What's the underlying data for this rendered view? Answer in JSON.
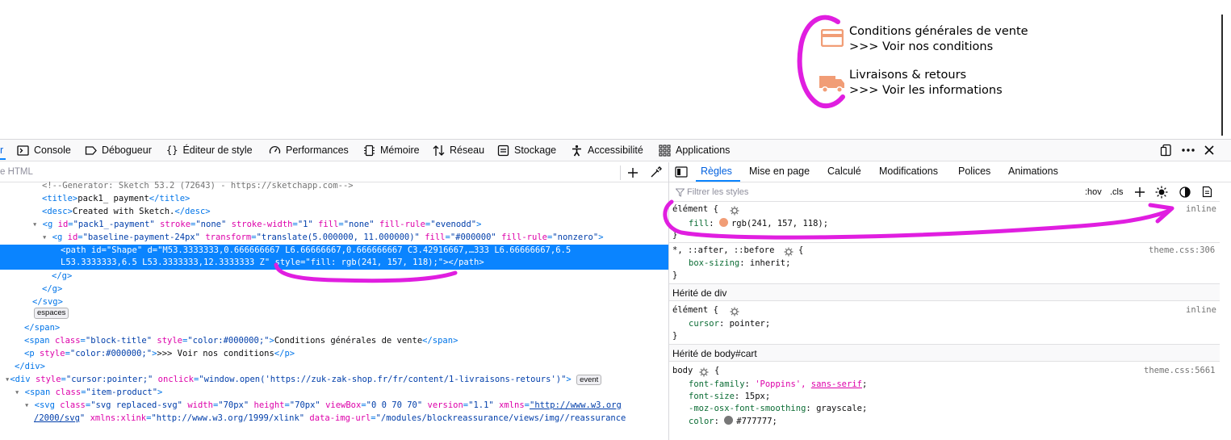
{
  "site": {
    "item1_title": "Conditions générales de vente",
    "item1_link": ">>> Voir nos conditions",
    "item2_title": "Livraisons & retours",
    "item2_link": ">>> Voir les informations",
    "icon_color": "#f19d76",
    "icon1": "credit-card-icon",
    "icon2": "delivery-truck-icon"
  },
  "toolbar": {
    "tabs": [
      "r",
      "Console",
      "Débogueur",
      "Éditeur de style",
      "Performances",
      "Mémoire",
      "Réseau",
      "Stockage",
      "Accessibilité",
      "Applications"
    ]
  },
  "inspector": {
    "search_placeholder": "e HTML",
    "lines": [
      "<!--Generator: Sketch 53.2 (72643) - https://sketchapp.com-->",
      "<title>pack1_ payment</title>",
      "<desc>Created with Sketch.</desc>",
      "<g id=\"pack1_-payment\" stroke=\"none\" stroke-width=\"1\" fill=\"none\" fill-rule=\"evenodd\">",
      "<g id=\"baseline-payment-24px\" transform=\"translate(5.000000, 11.000000)\" fill=\"#000000\" fill-rule=\"nonzero\">",
      "<path id=\"Shape\" d=\"M53.3333333,0.666666667 L6.66666667,0.666666667 C3.42916667,…333 L6.66666667,6.5",
      "L53.3333333,6.5 L53.3333333,12.3333333 Z\" style=\"fill: rgb(241, 157, 118);\"></path>",
      "</g>",
      "</g>",
      "</svg>",
      "espaces",
      "</span>",
      "<span class=\"block-title\" style=\"color:#000000;\">Conditions générales de vente</span>",
      "<p style=\"color:#000000;\">>>> Voir nos conditions</p>",
      "</div>",
      "<div style=\"cursor:pointer;\" onclick=\"window.open('https://zuk-zak-shop.fr/fr/content/1-livraisons-retours')\">",
      "event",
      "<span class=\"item-product\">",
      "<svg class=\"svg replaced-svg\" width=\"70px\" height=\"70px\" viewBox=\"0 0 70 70\" version=\"1.1\" xmlns=\"http://www.w3.org",
      "/2000/svg\" xmlns:xlink=\"http://www.w3.org/1999/xlink\" data-img-url=\"/modules/blockreassurance/views/img//reassurance"
    ]
  },
  "rules": {
    "tabs": [
      "Règles",
      "Mise en page",
      "Calculé",
      "Modifications",
      "Polices",
      "Animations"
    ],
    "filter_placeholder": "Filtrer les styles",
    "hov": ":hov",
    "cls": ".cls",
    "r1_selector": "élément {",
    "r1_prop": "fill",
    "r1_value": "rgb(241, 157, 118);",
    "r1_source": "inline",
    "r2_selector": "*, ::after, ::before",
    "r2_prop": "box-sizing",
    "r2_value": "inherit;",
    "r2_source": "theme.css:306",
    "inherit1": "Hérité de div",
    "r3_selector": "élément {",
    "r3_prop": "cursor",
    "r3_value": "pointer;",
    "r3_source": "inline",
    "inherit2": "Hérité de body#cart",
    "r4_selector": "body",
    "r4_source": "theme.css:5661",
    "r4_p1": "font-family",
    "r4_v1a": "'Poppins',",
    "r4_v1b": "sans-serif",
    "r4_p2": "font-size",
    "r4_v2": "15px;",
    "r4_p3": "-moz-osx-font-smoothing",
    "r4_v3": "grayscale;",
    "r4_p4": "color",
    "r4_v4": "#777777;",
    "brace_open": "{",
    "brace_close": "}"
  },
  "annotation_color": "#e01ee0"
}
